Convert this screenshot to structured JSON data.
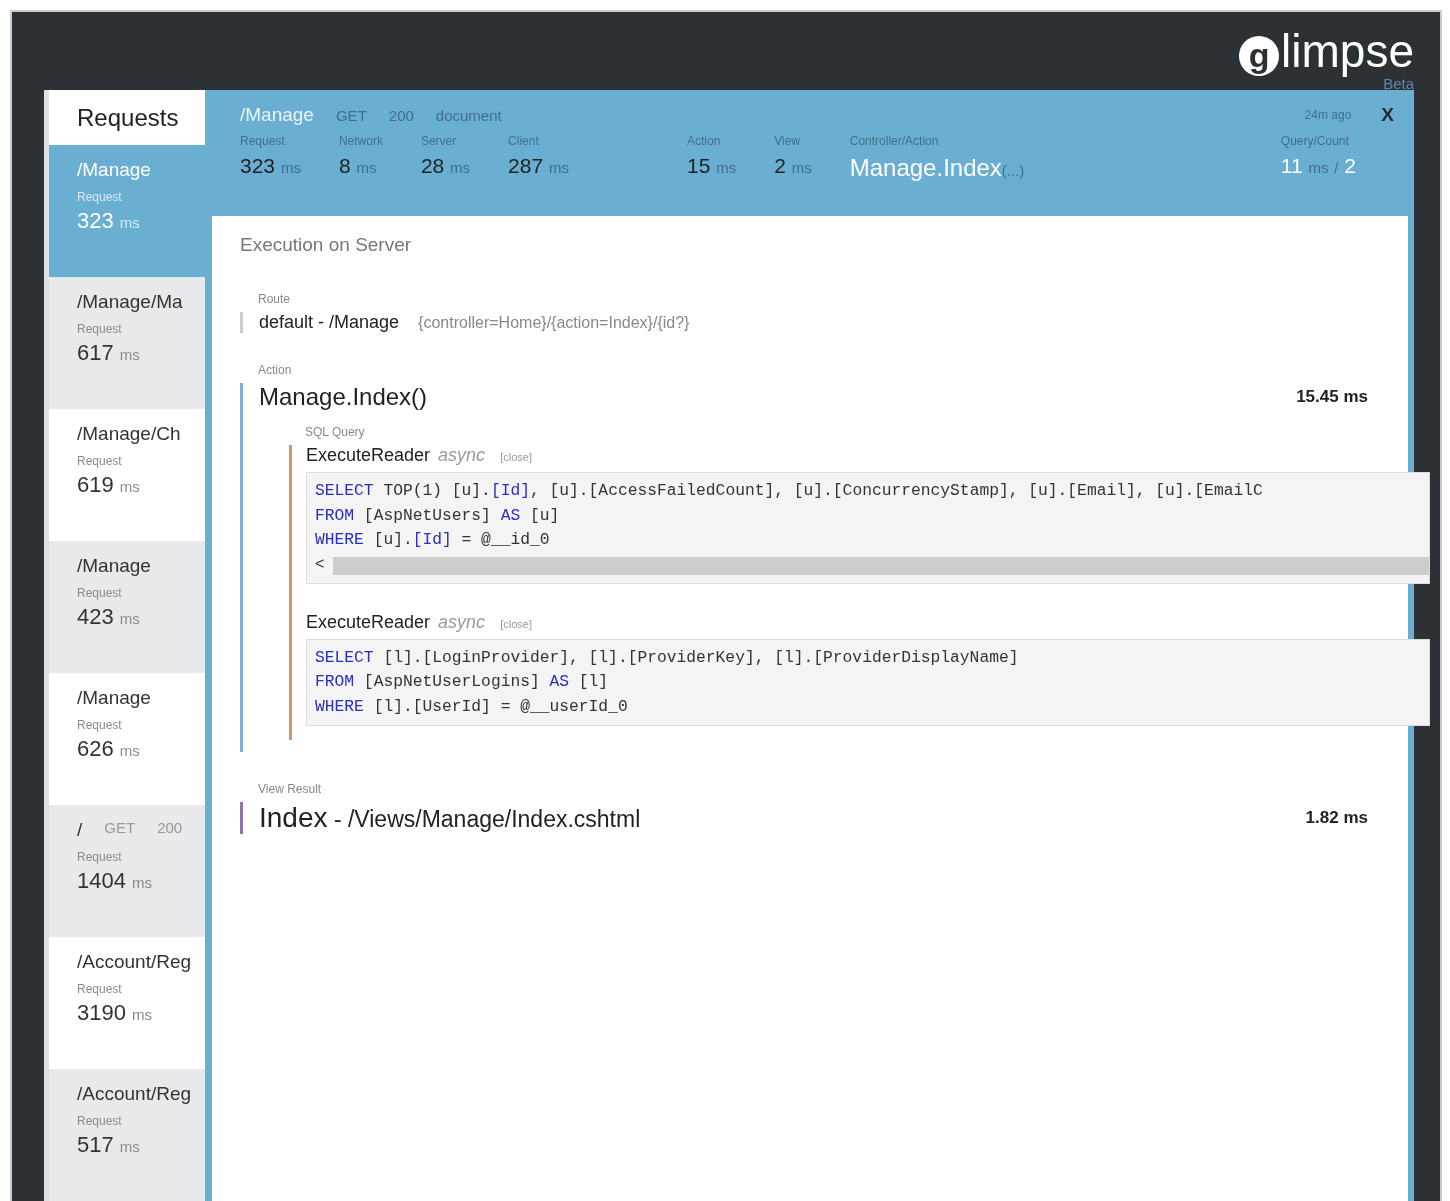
{
  "logo": {
    "glyph": "g",
    "text": "limpse",
    "badge": "Beta"
  },
  "sidebar": {
    "title": "Requests",
    "items": [
      {
        "path": "/Manage",
        "label": "Request",
        "value": "323",
        "unit": "ms",
        "selected": true
      },
      {
        "path": "/Manage/Ma",
        "label": "Request",
        "value": "617",
        "unit": "ms",
        "selected": false
      },
      {
        "path": "/Manage/Ch",
        "label": "Request",
        "value": "619",
        "unit": "ms",
        "selected": false
      },
      {
        "path": "/Manage",
        "label": "Request",
        "value": "423",
        "unit": "ms",
        "selected": false
      },
      {
        "path": "/Manage",
        "label": "Request",
        "value": "626",
        "unit": "ms",
        "selected": false
      },
      {
        "path": "/",
        "method": "GET",
        "status": "200",
        "label": "Request",
        "value": "1404",
        "unit": "ms",
        "selected": false
      },
      {
        "path": "/Account/Reg",
        "label": "Request",
        "value": "3190",
        "unit": "ms",
        "selected": false
      },
      {
        "path": "/Account/Reg",
        "label": "Request",
        "value": "517",
        "unit": "ms",
        "selected": false
      }
    ]
  },
  "header": {
    "path": "/Manage",
    "method": "GET",
    "status": "200",
    "type": "document",
    "age": "24m ago",
    "close": "X",
    "metrics": [
      {
        "kind": "time",
        "label": "Request",
        "value": "323",
        "unit": "ms"
      },
      {
        "kind": "time",
        "label": "Network",
        "value": "8",
        "unit": "ms"
      },
      {
        "kind": "time",
        "label": "Server",
        "value": "28",
        "unit": "ms"
      },
      {
        "kind": "time",
        "label": "Client",
        "value": "287",
        "unit": "ms"
      },
      {
        "kind": "gap"
      },
      {
        "kind": "time",
        "label": "Action",
        "value": "15",
        "unit": "ms"
      },
      {
        "kind": "time",
        "label": "View",
        "value": "2",
        "unit": "ms"
      },
      {
        "kind": "name",
        "label": "Controller/Action",
        "value": "Manage.Index",
        "unit": "(...)"
      },
      {
        "kind": "gap"
      },
      {
        "kind": "count",
        "label": "Query/Count",
        "value": "11",
        "unit": "ms",
        "sep": "/",
        "count": "2"
      }
    ]
  },
  "main": {
    "title": "Execution on Server",
    "route": {
      "label": "Route",
      "name": "default - /Manage",
      "template": "{controller=Home}/{action=Index}/{id?}"
    },
    "action": {
      "label": "Action",
      "name": "Manage.Index()",
      "time": "15.45 ms",
      "sql_label": "SQL Query",
      "queries": [
        {
          "command": "ExecuteReader",
          "mode": "async",
          "close": "[close]",
          "scroll": "<",
          "lines": [
            [
              {
                "kind": "keyword",
                "text": "SELECT"
              },
              {
                "kind": "plain",
                "text": " TOP(1) [u]."
              },
              {
                "kind": "keyword",
                "text": "[Id]"
              },
              {
                "kind": "plain",
                "text": ", [u].[AccessFailedCount], [u].[ConcurrencyStamp], [u].[Email], [u].[EmailC"
              }
            ],
            [
              {
                "kind": "keyword",
                "text": "FROM"
              },
              {
                "kind": "plain",
                "text": " [AspNetUsers] "
              },
              {
                "kind": "keyword",
                "text": "AS"
              },
              {
                "kind": "plain",
                "text": " [u]"
              }
            ],
            [
              {
                "kind": "keyword",
                "text": "WHERE"
              },
              {
                "kind": "plain",
                "text": " [u]."
              },
              {
                "kind": "keyword",
                "text": "[Id]"
              },
              {
                "kind": "plain",
                "text": " = @__id_0"
              }
            ]
          ]
        },
        {
          "command": "ExecuteReader",
          "mode": "async",
          "close": "[close]",
          "lines": [
            [
              {
                "kind": "keyword",
                "text": "SELECT"
              },
              {
                "kind": "plain",
                "text": " [l].[LoginProvider], [l].[ProviderKey], [l].[ProviderDisplayName]"
              }
            ],
            [
              {
                "kind": "keyword",
                "text": "FROM"
              },
              {
                "kind": "plain",
                "text": " [AspNetUserLogins] "
              },
              {
                "kind": "keyword",
                "text": "AS"
              },
              {
                "kind": "plain",
                "text": " [l]"
              }
            ],
            [
              {
                "kind": "keyword",
                "text": "WHERE"
              },
              {
                "kind": "plain",
                "text": " [l].[UserId] = @__userId_0"
              }
            ]
          ]
        }
      ]
    },
    "view": {
      "label": "View Result",
      "name": "Index",
      "path": " - /Views/Manage/Index.cshtml",
      "time": "1.82 ms"
    }
  }
}
